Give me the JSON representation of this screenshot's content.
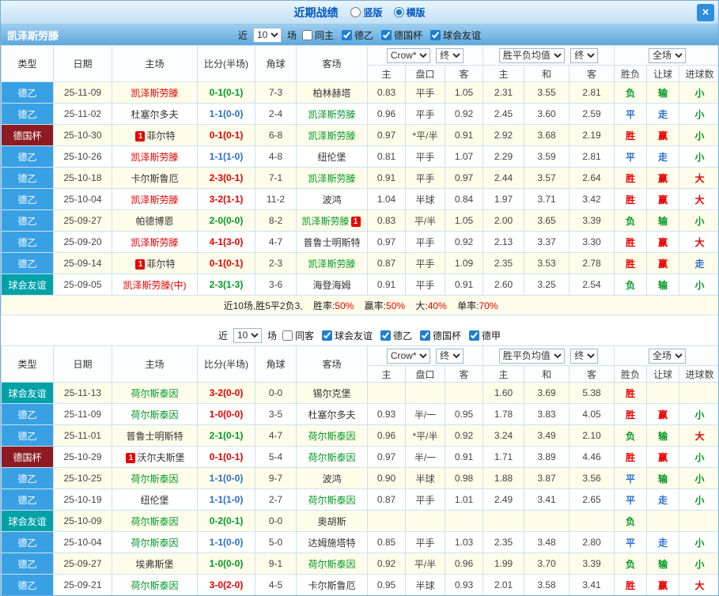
{
  "titlebar": {
    "title": "近期战绩",
    "radio_vertical": "竖版",
    "radio_horizontal": "横版",
    "selected": "横版",
    "close": "×"
  },
  "headers": {
    "type": "类型",
    "date": "日期",
    "home": "主场",
    "score": "比分(半场)",
    "corner": "角球",
    "away": "客场",
    "company_select": "Crow*",
    "final_label": "终",
    "avg_select": "胜平负均值",
    "fulltime_select": "全场",
    "sub": [
      "主",
      "盘口",
      "客",
      "主",
      "和",
      "客",
      "胜负",
      "让球",
      "进球数"
    ]
  },
  "colors": {
    "win": "#e80000",
    "draw": "#2a6fce",
    "loss": "#009927",
    "league_de2": "#3aa0e4",
    "league_cup": "#8d1b21",
    "league_friendly": "#00a2a8"
  },
  "sections": [
    {
      "team": "凯泽斯劳滕",
      "filter": {
        "near_label": "近",
        "count": "10",
        "games_label": "场",
        "checkboxes": [
          {
            "label": "同主",
            "checked": false
          },
          {
            "label": "德乙",
            "checked": true
          },
          {
            "label": "德国杯",
            "checked": true
          },
          {
            "label": "球会友谊",
            "checked": true
          }
        ]
      },
      "rows": [
        {
          "league": "德乙",
          "date": "25-11-09",
          "home": {
            "name": "凯泽斯劳滕",
            "color": "red"
          },
          "score": {
            "text": "0-1(0-1)",
            "color": "green"
          },
          "corner": "7-3",
          "away": {
            "name": "柏林赫塔",
            "color": "black"
          },
          "asian": [
            "0.83",
            "平手",
            "1.05"
          ],
          "europe": [
            "2.31",
            "3.55",
            "2.81"
          ],
          "result": {
            "text": "负",
            "color": "green"
          },
          "handicap": {
            "text": "输",
            "color": "green"
          },
          "goals": {
            "text": "小",
            "color": "green"
          }
        },
        {
          "league": "德乙",
          "date": "25-11-02",
          "home": {
            "name": "杜塞尔多夫",
            "color": "black"
          },
          "score": {
            "text": "1-1(0-0)",
            "color": "blue"
          },
          "corner": "2-4",
          "away": {
            "name": "凯泽斯劳滕",
            "color": "green"
          },
          "asian": [
            "0.96",
            "平手",
            "0.92"
          ],
          "europe": [
            "2.45",
            "3.60",
            "2.59"
          ],
          "result": {
            "text": "平",
            "color": "blue"
          },
          "handicap": {
            "text": "走",
            "color": "blue"
          },
          "goals": {
            "text": "小",
            "color": "green"
          }
        },
        {
          "league": "德国杯",
          "date": "25-10-30",
          "home": {
            "name": "菲尔特",
            "color": "black",
            "badge_before": "1"
          },
          "score": {
            "text": "0-1(0-1)",
            "color": "red"
          },
          "corner": "6-8",
          "away": {
            "name": "凯泽斯劳滕",
            "color": "green"
          },
          "asian": [
            "0.97",
            "*平/半",
            "0.91"
          ],
          "europe": [
            "2.92",
            "3.68",
            "2.19"
          ],
          "result": {
            "text": "胜",
            "color": "red"
          },
          "handicap": {
            "text": "赢",
            "color": "red"
          },
          "goals": {
            "text": "小",
            "color": "green"
          }
        },
        {
          "league": "德乙",
          "date": "25-10-26",
          "home": {
            "name": "凯泽斯劳滕",
            "color": "red"
          },
          "score": {
            "text": "1-1(1-0)",
            "color": "blue"
          },
          "corner": "4-8",
          "away": {
            "name": "纽伦堡",
            "color": "black"
          },
          "asian": [
            "0.81",
            "平手",
            "1.07"
          ],
          "europe": [
            "2.29",
            "3.59",
            "2.81"
          ],
          "result": {
            "text": "平",
            "color": "blue"
          },
          "handicap": {
            "text": "走",
            "color": "blue"
          },
          "goals": {
            "text": "小",
            "color": "green"
          }
        },
        {
          "league": "德乙",
          "date": "25-10-18",
          "home": {
            "name": "卡尔斯鲁厄",
            "color": "black"
          },
          "score": {
            "text": "2-3(0-1)",
            "color": "red"
          },
          "corner": "7-1",
          "away": {
            "name": "凯泽斯劳滕",
            "color": "green"
          },
          "asian": [
            "0.91",
            "平手",
            "0.97"
          ],
          "europe": [
            "2.44",
            "3.57",
            "2.64"
          ],
          "result": {
            "text": "胜",
            "color": "red"
          },
          "handicap": {
            "text": "赢",
            "color": "red"
          },
          "goals": {
            "text": "大",
            "color": "red"
          }
        },
        {
          "league": "德乙",
          "date": "25-10-04",
          "home": {
            "name": "凯泽斯劳滕",
            "color": "red"
          },
          "score": {
            "text": "3-2(1-1)",
            "color": "red"
          },
          "corner": "11-2",
          "away": {
            "name": "波鸿",
            "color": "black"
          },
          "asian": [
            "1.04",
            "半球",
            "0.84"
          ],
          "europe": [
            "1.97",
            "3.71",
            "3.42"
          ],
          "result": {
            "text": "胜",
            "color": "red"
          },
          "handicap": {
            "text": "赢",
            "color": "red"
          },
          "goals": {
            "text": "大",
            "color": "red"
          }
        },
        {
          "league": "德乙",
          "date": "25-09-27",
          "home": {
            "name": "帕德博恩",
            "color": "black"
          },
          "score": {
            "text": "2-0(0-0)",
            "color": "green"
          },
          "corner": "8-2",
          "away": {
            "name": "凯泽斯劳滕",
            "color": "green",
            "badge_after": "1"
          },
          "asian": [
            "0.83",
            "平/半",
            "1.05"
          ],
          "europe": [
            "2.00",
            "3.65",
            "3.39"
          ],
          "result": {
            "text": "负",
            "color": "green"
          },
          "handicap": {
            "text": "输",
            "color": "green"
          },
          "goals": {
            "text": "小",
            "color": "green"
          }
        },
        {
          "league": "德乙",
          "date": "25-09-20",
          "home": {
            "name": "凯泽斯劳滕",
            "color": "red"
          },
          "score": {
            "text": "4-1(3-0)",
            "color": "red"
          },
          "corner": "4-7",
          "away": {
            "name": "普鲁士明斯特",
            "color": "black"
          },
          "asian": [
            "0.97",
            "平手",
            "0.92"
          ],
          "europe": [
            "2.13",
            "3.37",
            "3.30"
          ],
          "result": {
            "text": "胜",
            "color": "red"
          },
          "handicap": {
            "text": "赢",
            "color": "red"
          },
          "goals": {
            "text": "大",
            "color": "red"
          }
        },
        {
          "league": "德乙",
          "date": "25-09-14",
          "home": {
            "name": "菲尔特",
            "color": "black",
            "badge_before": "1"
          },
          "score": {
            "text": "0-1(0-1)",
            "color": "red"
          },
          "corner": "2-3",
          "away": {
            "name": "凯泽斯劳滕",
            "color": "green"
          },
          "asian": [
            "0.87",
            "平手",
            "1.09"
          ],
          "europe": [
            "2.35",
            "3.53",
            "2.78"
          ],
          "result": {
            "text": "胜",
            "color": "red"
          },
          "handicap": {
            "text": "赢",
            "color": "red"
          },
          "goals": {
            "text": "走",
            "color": "blue"
          }
        },
        {
          "league": "球会友谊",
          "date": "25-09-05",
          "home": {
            "name": "凯泽斯劳滕(中)",
            "color": "red"
          },
          "score": {
            "text": "2-3(1-3)",
            "color": "green"
          },
          "corner": "3-6",
          "away": {
            "name": "海登海姆",
            "color": "black"
          },
          "asian": [
            "0.91",
            "平手",
            "0.91"
          ],
          "europe": [
            "2.60",
            "3.25",
            "2.54"
          ],
          "result": {
            "text": "负",
            "color": "green"
          },
          "handicap": {
            "text": "输",
            "color": "green"
          },
          "goals": {
            "text": "小",
            "color": "green"
          }
        }
      ],
      "summary": {
        "prefix": "近10场,胜5平2负3,",
        "stats": [
          {
            "label": "胜率:",
            "value": "50%"
          },
          {
            "label": "赢率:",
            "value": "50%"
          },
          {
            "label": "大:",
            "value": "40%"
          },
          {
            "label": "单率:",
            "value": "70%"
          }
        ]
      }
    },
    {
      "team": "",
      "filter": {
        "near_label": "近",
        "count": "10",
        "games_label": "场",
        "checkboxes": [
          {
            "label": "同客",
            "checked": false
          },
          {
            "label": "球会友谊",
            "checked": true
          },
          {
            "label": "德乙",
            "checked": true
          },
          {
            "label": "德国杯",
            "checked": true
          },
          {
            "label": "德甲",
            "checked": true
          }
        ]
      },
      "rows": [
        {
          "league": "球会友谊",
          "date": "25-11-13",
          "home": {
            "name": "荷尔斯泰因",
            "color": "green"
          },
          "score": {
            "text": "3-2(0-0)",
            "color": "red"
          },
          "corner": "0-0",
          "away": {
            "name": "锡尔克堡",
            "color": "black"
          },
          "asian": [
            "",
            "",
            ""
          ],
          "europe": [
            "1.60",
            "3.69",
            "5.38"
          ],
          "result": {
            "text": "胜",
            "color": "red"
          },
          "handicap": {
            "text": "",
            "color": "black"
          },
          "goals": {
            "text": "",
            "color": "black"
          }
        },
        {
          "league": "德乙",
          "date": "25-11-09",
          "home": {
            "name": "荷尔斯泰因",
            "color": "green"
          },
          "score": {
            "text": "1-0(0-0)",
            "color": "red"
          },
          "corner": "3-5",
          "away": {
            "name": "杜塞尔多夫",
            "color": "black"
          },
          "asian": [
            "0.93",
            "半/一",
            "0.95"
          ],
          "europe": [
            "1.78",
            "3.83",
            "4.05"
          ],
          "result": {
            "text": "胜",
            "color": "red"
          },
          "handicap": {
            "text": "赢",
            "color": "red"
          },
          "goals": {
            "text": "小",
            "color": "green"
          }
        },
        {
          "league": "德乙",
          "date": "25-11-01",
          "home": {
            "name": "普鲁士明斯特",
            "color": "black"
          },
          "score": {
            "text": "2-1(0-1)",
            "color": "green"
          },
          "corner": "4-7",
          "away": {
            "name": "荷尔斯泰因",
            "color": "green"
          },
          "asian": [
            "0.96",
            "*平/半",
            "0.92"
          ],
          "europe": [
            "3.24",
            "3.49",
            "2.10"
          ],
          "result": {
            "text": "负",
            "color": "green"
          },
          "handicap": {
            "text": "输",
            "color": "green"
          },
          "goals": {
            "text": "大",
            "color": "red"
          }
        },
        {
          "league": "德国杯",
          "date": "25-10-29",
          "home": {
            "name": "沃尔夫斯堡",
            "color": "black",
            "badge_before": "1"
          },
          "score": {
            "text": "0-1(0-1)",
            "color": "red"
          },
          "corner": "5-4",
          "away": {
            "name": "荷尔斯泰因",
            "color": "green"
          },
          "asian": [
            "0.97",
            "半/一",
            "0.91"
          ],
          "europe": [
            "1.71",
            "3.89",
            "4.46"
          ],
          "result": {
            "text": "胜",
            "color": "red"
          },
          "handicap": {
            "text": "赢",
            "color": "red"
          },
          "goals": {
            "text": "小",
            "color": "green"
          }
        },
        {
          "league": "德乙",
          "date": "25-10-25",
          "home": {
            "name": "荷尔斯泰因",
            "color": "green"
          },
          "score": {
            "text": "1-1(0-0)",
            "color": "blue"
          },
          "corner": "9-7",
          "away": {
            "name": "波鸿",
            "color": "black"
          },
          "asian": [
            "0.90",
            "半球",
            "0.98"
          ],
          "europe": [
            "1.88",
            "3.87",
            "3.56"
          ],
          "result": {
            "text": "平",
            "color": "blue"
          },
          "handicap": {
            "text": "输",
            "color": "green"
          },
          "goals": {
            "text": "小",
            "color": "green"
          }
        },
        {
          "league": "德乙",
          "date": "25-10-19",
          "home": {
            "name": "纽伦堡",
            "color": "black"
          },
          "score": {
            "text": "1-1(1-0)",
            "color": "blue"
          },
          "corner": "2-7",
          "away": {
            "name": "荷尔斯泰因",
            "color": "green"
          },
          "asian": [
            "0.87",
            "平手",
            "1.01"
          ],
          "europe": [
            "2.49",
            "3.41",
            "2.65"
          ],
          "result": {
            "text": "平",
            "color": "blue"
          },
          "handicap": {
            "text": "走",
            "color": "blue"
          },
          "goals": {
            "text": "小",
            "color": "green"
          }
        },
        {
          "league": "球会友谊",
          "date": "25-10-09",
          "home": {
            "name": "荷尔斯泰因",
            "color": "green"
          },
          "score": {
            "text": "0-2(0-1)",
            "color": "green"
          },
          "corner": "0-0",
          "away": {
            "name": "奥胡斯",
            "color": "black"
          },
          "asian": [
            "",
            "",
            ""
          ],
          "europe": [
            "",
            "",
            ""
          ],
          "result": {
            "text": "负",
            "color": "green"
          },
          "handicap": {
            "text": "",
            "color": "black"
          },
          "goals": {
            "text": "",
            "color": "black"
          }
        },
        {
          "league": "德乙",
          "date": "25-10-04",
          "home": {
            "name": "荷尔斯泰因",
            "color": "green"
          },
          "score": {
            "text": "1-1(0-0)",
            "color": "blue"
          },
          "corner": "5-0",
          "away": {
            "name": "达姆施塔特",
            "color": "black"
          },
          "asian": [
            "0.85",
            "平手",
            "1.03"
          ],
          "europe": [
            "2.35",
            "3.48",
            "2.80"
          ],
          "result": {
            "text": "平",
            "color": "blue"
          },
          "handicap": {
            "text": "走",
            "color": "blue"
          },
          "goals": {
            "text": "小",
            "color": "green"
          }
        },
        {
          "league": "德乙",
          "date": "25-09-27",
          "home": {
            "name": "埃弗斯堡",
            "color": "black"
          },
          "score": {
            "text": "1-0(0-0)",
            "color": "green"
          },
          "corner": "9-1",
          "away": {
            "name": "荷尔斯泰因",
            "color": "green"
          },
          "asian": [
            "0.92",
            "平/半",
            "0.96"
          ],
          "europe": [
            "1.99",
            "3.70",
            "3.39"
          ],
          "result": {
            "text": "负",
            "color": "green"
          },
          "handicap": {
            "text": "输",
            "color": "green"
          },
          "goals": {
            "text": "小",
            "color": "green"
          }
        },
        {
          "league": "德乙",
          "date": "25-09-21",
          "home": {
            "name": "荷尔斯泰因",
            "color": "green"
          },
          "score": {
            "text": "3-0(2-0)",
            "color": "red"
          },
          "corner": "4-5",
          "away": {
            "name": "卡尔斯鲁厄",
            "color": "black"
          },
          "asian": [
            "0.95",
            "半球",
            "0.93"
          ],
          "europe": [
            "2.01",
            "3.58",
            "3.41"
          ],
          "result": {
            "text": "胜",
            "color": "red"
          },
          "handicap": {
            "text": "赢",
            "color": "red"
          },
          "goals": {
            "text": "大",
            "color": "red"
          }
        }
      ]
    }
  ]
}
